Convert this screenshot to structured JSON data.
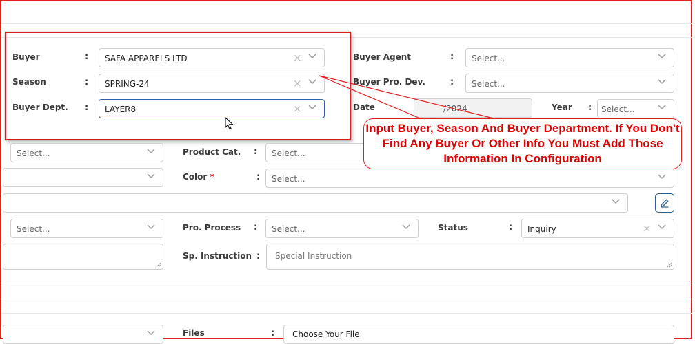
{
  "highlight_box": {
    "buyer": {
      "label": "Buyer",
      "value": "SAFA APPARELS LTD"
    },
    "season": {
      "label": "Season",
      "value": "SPRING-24"
    },
    "buyer_dept": {
      "label": "Buyer Dept.",
      "value": "LAYER8"
    }
  },
  "right_top": {
    "buyer_agent": {
      "label": "Buyer Agent",
      "placeholder": "Select..."
    },
    "buyer_pro_dev": {
      "label": "Buyer Pro. Dev.",
      "placeholder": "Select..."
    },
    "date": {
      "label": "Date",
      "value": "/2024"
    },
    "year": {
      "label": "Year",
      "placeholder": "Select..."
    }
  },
  "callout": {
    "text": "Input Buyer, Season And Buyer Department. If You Don't Find Any Buyer Or Other Info You Must Add Those Information In Configuration"
  },
  "row_product": {
    "left_placeholder": "Select...",
    "product_cat": {
      "label": "Product Cat.",
      "placeholder": "Select..."
    }
  },
  "row_color": {
    "color": {
      "label": "Color",
      "required_mark": "*",
      "placeholder": "Select..."
    }
  },
  "row_process": {
    "left_placeholder": "Select...",
    "pro_process": {
      "label": "Pro. Process",
      "placeholder": "Select..."
    },
    "status": {
      "label": "Status",
      "value": "Inquiry"
    }
  },
  "row_instruction": {
    "sp_instruction": {
      "label": "Sp. Instruction",
      "placeholder": "Special Instruction"
    }
  },
  "row_files": {
    "files": {
      "label": "Files",
      "button_label": "Choose Your File"
    }
  },
  "colon": ":",
  "clear_glyph": "×",
  "colors": {
    "accent_red": "#e02020",
    "focus_blue": "#2b62a8"
  }
}
